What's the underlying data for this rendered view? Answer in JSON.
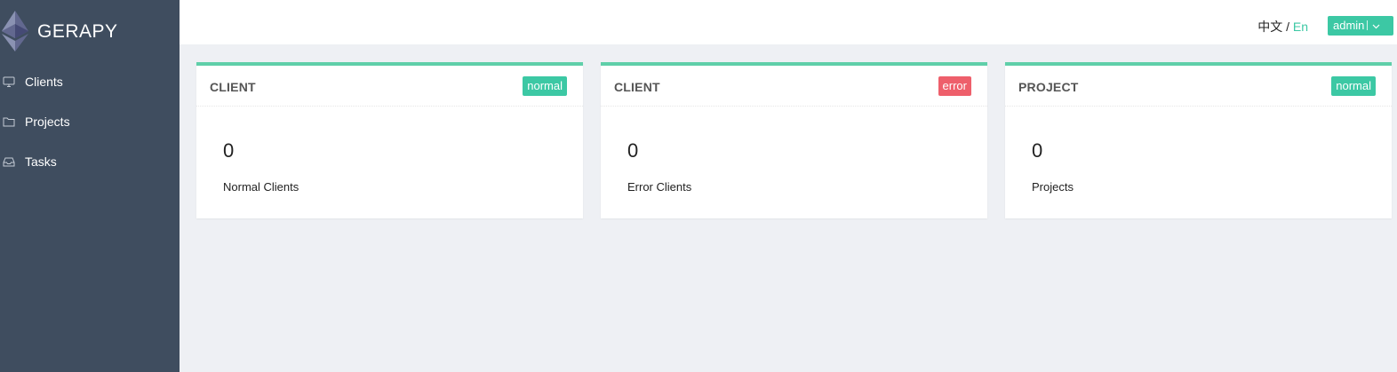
{
  "sidebar": {
    "brand": "GERAPY",
    "items": [
      {
        "label": "Clients",
        "icon": "monitor-icon"
      },
      {
        "label": "Projects",
        "icon": "folder-icon"
      },
      {
        "label": "Tasks",
        "icon": "inbox-icon"
      }
    ]
  },
  "header": {
    "lang_zh": "中文",
    "lang_sep": "/",
    "lang_en": "En",
    "user": "admin"
  },
  "cards": [
    {
      "title": "CLIENT",
      "badge": "normal",
      "count": "0",
      "label": "Normal Clients"
    },
    {
      "title": "CLIENT",
      "badge": "error",
      "count": "0",
      "label": "Error Clients"
    },
    {
      "title": "PROJECT",
      "badge": "normal",
      "count": "0",
      "label": "Projects"
    }
  ],
  "colors": {
    "sidebar_bg": "#3f4d5f",
    "accent": "#3cc8a4",
    "error": "#ee5f6b",
    "content_bg": "#eef0f4"
  }
}
